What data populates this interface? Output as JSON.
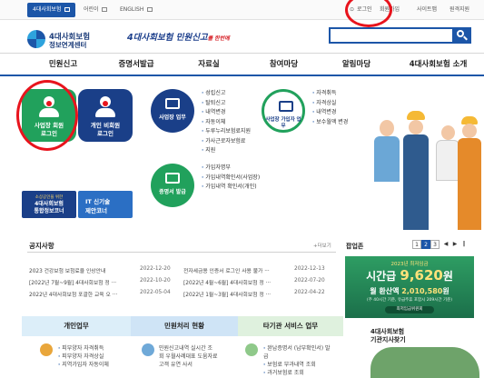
{
  "topbar": {
    "tabs": [
      "4대사회보험",
      "어린이",
      "ENGLISH"
    ],
    "util_links": [
      "로그인",
      "회원가입",
      "사이트맵",
      "원격지원"
    ]
  },
  "header": {
    "logo_line1": "4대사회보험",
    "logo_line2": "정보연계센터",
    "slogan_main": "4대사회보험 민원신고",
    "slogan_sub": "를 한번에",
    "search_placeholder": ""
  },
  "gnb": [
    "민원신고",
    "증명서발급",
    "자료실",
    "참여마당",
    "알림마당",
    "4대사회보험 소개"
  ],
  "left_buttons": {
    "business": {
      "line1": "사업장 회원",
      "line2": "로그인"
    },
    "personal": {
      "line1": "개인 비회원",
      "line2": "로그인"
    },
    "smallbiz": {
      "line1": "소상공인을 위한",
      "line2": "4대사회보험",
      "line3": "통합정보코너"
    },
    "it": {
      "line1": "IT 신기술",
      "line2": "제안코너"
    }
  },
  "services": {
    "business_work": {
      "label": "사업장 업무",
      "items": [
        "성립신고",
        "탈퇴신고",
        "내역변경",
        "자동이체",
        "두루누리보험료지원",
        "가사근로자보험료",
        "지원"
      ]
    },
    "member_work": {
      "label": "사업장 가입자 업무",
      "items": [
        "자격취득",
        "자격상실",
        "내역변경",
        "보수월액 변경"
      ]
    },
    "certificate": {
      "label": "증명서 발급",
      "items": [
        "가입자명부",
        "가입내역확인서(사업장)",
        "가입내역 확인서(개인)"
      ]
    }
  },
  "notices": {
    "title": "공지사항",
    "more": "+더보기",
    "rows": [
      {
        "title": "2023 건강보험 보험료율 인상안내",
        "date": "2022-12-20",
        "title2": "전자세금용 인증서 로그인 사용 불가 ···",
        "date2": "2022-12-13"
      },
      {
        "title": "[2022년 7월~9월] 4대사회보험 정 ···",
        "date": "2022-10-20",
        "title2": "[2022년 4월~6월] 4대사회보험 정 ···",
        "date2": "2022-07-20"
      },
      {
        "title": "2022년 4대사회보험 포괄한 교육 오 ···",
        "date": "2022-05-04",
        "title2": "[2022년 1월~3월] 4대사회보험 정 ···",
        "date2": "2022-04-22"
      }
    ]
  },
  "popup_zone": {
    "title": "팝업존",
    "pages": [
      "1",
      "2",
      "3"
    ],
    "active_page": "2",
    "banner": {
      "year": "2023년 최저임금",
      "hourly_label": "시간급",
      "hourly_value": "9,620",
      "unit": "원",
      "monthly_label": "월 환산액",
      "monthly_value": "2,010,580",
      "monthly_unit": "원",
      "note": "(주 40시간 기준, 유급주휴 포함시 209시간 기준)",
      "badge": "최저임금위원회"
    }
  },
  "bottom_tabs": [
    "개인업무",
    "민원처리 현황",
    "타기관 서비스 업무"
  ],
  "bottom_personal": [
    "피부양자 자격취득",
    "피부양자 자격상실",
    "지역가입자 자동이체"
  ],
  "bottom_status": [
    "민원신고내역 실시간 조",
    "회 우월사례대표 도움자료",
    "고객 유연 사서"
  ],
  "bottom_other": [
    "완납증명서 (납부확인서) 발",
    "급",
    "보험료 부과내역 조회",
    "과거보험료 조회"
  ],
  "regional": {
    "line1": "4대사회보험",
    "line2": "기관지사찾기"
  }
}
